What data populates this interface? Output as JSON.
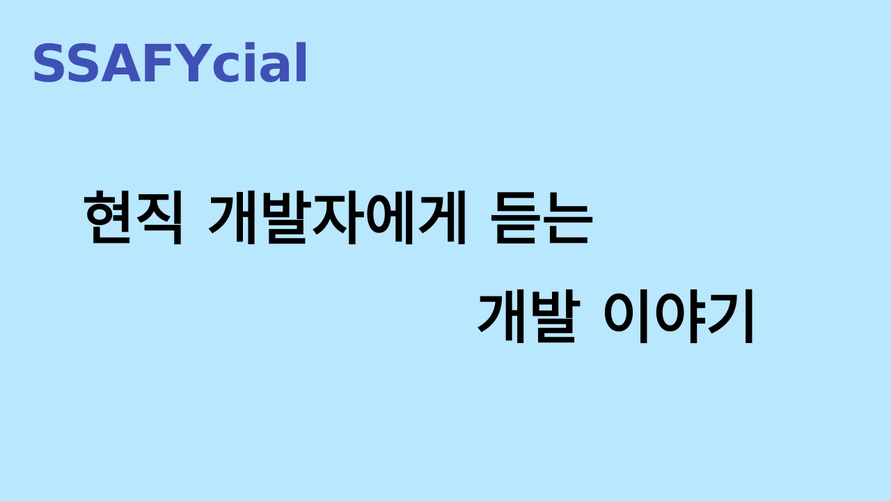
{
  "brand": {
    "name": "SSAFYcial"
  },
  "title": {
    "line1": "현직 개발자에게 듣는",
    "line2": "개발 이야기"
  },
  "colors": {
    "background": "#B9E7FD",
    "brand_text": "#3F51B5",
    "title_text": "#000000"
  }
}
